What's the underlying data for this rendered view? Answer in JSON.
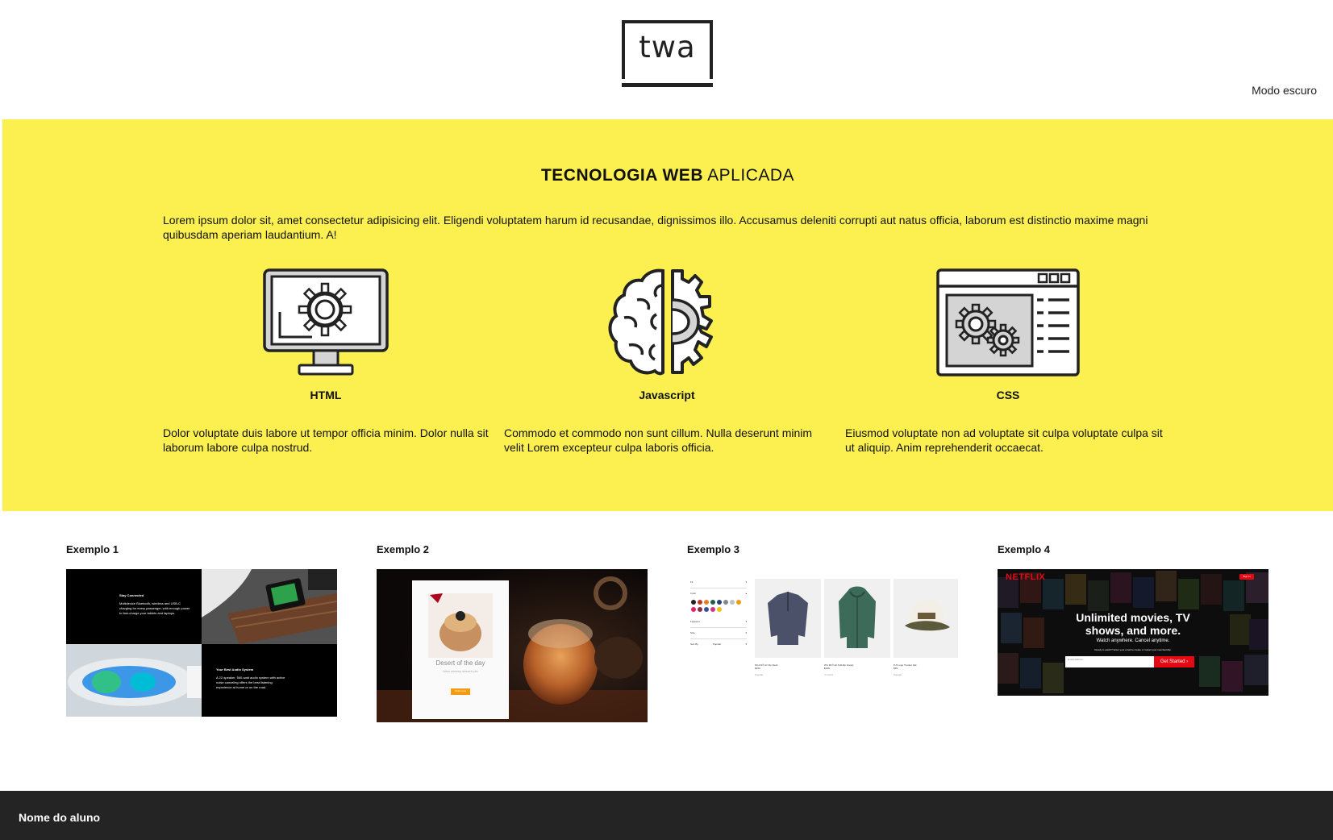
{
  "header": {
    "logo_text": "twa",
    "dark_mode_label": "Modo escuro"
  },
  "hero": {
    "title_bold": "TECNOLOGIA WEB",
    "title_light": "APLICADA",
    "intro": "Lorem ipsum dolor sit, amet consectetur adipisicing elit. Eligendi voluptatem harum id recusandae, dignissimos illo. Accusamus deleniti corrupti aut natus officia, laborum est distinctio maxime magni quibusdam aperiam laudantium. A!",
    "features": [
      {
        "title": "HTML",
        "icon": "monitor-gear-icon",
        "description": "Dolor voluptate duis labore ut tempor officia minim. Dolor nulla sit laborum labore culpa nostrud."
      },
      {
        "title": "Javascript",
        "icon": "brain-gear-icon",
        "description": "Commodo et commodo non sunt cillum. Nulla deserunt minim velit Lorem excepteur culpa laboris officia."
      },
      {
        "title": "CSS",
        "icon": "browser-gears-icon",
        "description": "Eiusmod voluptate non ad voluptate sit culpa voluptate culpa sit ut aliquip. Anim reprehenderit occaecat."
      }
    ],
    "background_color": "#fbf050"
  },
  "examples": [
    {
      "label": "Exemplo 1"
    },
    {
      "label": "Exemplo 2"
    },
    {
      "label": "Exemplo 3"
    },
    {
      "label": "Exemplo 4"
    }
  ],
  "example1": {
    "block1_title": "Stay Connected",
    "block1_text": "Multidevice Bluetooth, wireless and USB-C charging for every passenger, with enough power to fast-charge your tablets and laptops.",
    "block2_title": "Your Best Audio System",
    "block2_text": "A 22-speaker, 560-watt audio system with active noise canceling offers the best listening experience at home or on the road."
  },
  "example2": {
    "card_title": "Desert of the day",
    "card_subtitle": "Ultra creamy dessert pie",
    "button_label": "Order now"
  },
  "example3": {
    "filters": [
      "Fit",
      "Color",
      "Features",
      "Size",
      "Sort By"
    ],
    "sort_value": "Popular",
    "swatch_colors": [
      "#222222",
      "#c0392b",
      "#e67e22",
      "#1f5f4a",
      "#2c3e7a",
      "#7f8c8d",
      "#bdc3c7",
      "#f39c12",
      "#e91e63",
      "#8e2c48",
      "#3a4e9c",
      "#d63384",
      "#f1c40f"
    ],
    "products": [
      {
        "name": "M's R1® Air Zip-Neck",
        "price": "$159",
        "note": "Popular"
      },
      {
        "name": "W's R1® Air Full-Zip Hoody",
        "price": "$199",
        "note": "3 Colors"
      },
      {
        "name": "P-6 Logo Trucker Hat",
        "price": "$39",
        "note": "Popular"
      }
    ]
  },
  "example4": {
    "brand": "NETFLIX",
    "sign_in": "Sign In",
    "headline": "Unlimited movies, TV shows, and more.",
    "subline": "Watch anywhere. Cancel anytime.",
    "prompt": "Ready to watch? Enter your email to create or restart your membership.",
    "email_placeholder": "Email address",
    "cta": "Get Started ›",
    "accent": "#e50914"
  },
  "footer": {
    "student_name": "Nome do aluno"
  }
}
